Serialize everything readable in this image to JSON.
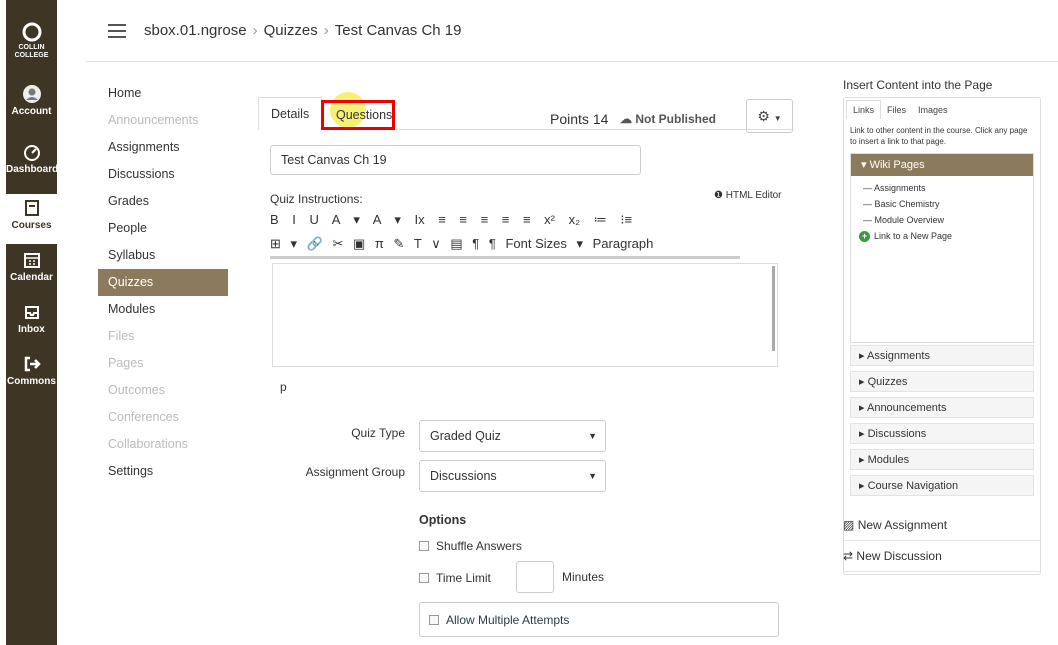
{
  "global_nav": {
    "logo": "COLLIN\nCOLLEGE",
    "account": "Account",
    "dashboard": "Dashboard",
    "courses": "Courses",
    "calendar": "Calendar",
    "inbox": "Inbox",
    "commons": "Commons"
  },
  "breadcrumb": {
    "course": "sbox.01.ngrose",
    "section": "Quizzes",
    "page": "Test Canvas Ch 19"
  },
  "course_nav": [
    "Home",
    "Announcements",
    "Assignments",
    "Discussions",
    "Grades",
    "People",
    "Syllabus",
    "Quizzes",
    "Modules",
    "Files",
    "Pages",
    "Outcomes",
    "Conferences",
    "Collaborations",
    "Settings"
  ],
  "course_nav_disabled": [
    1,
    9,
    10,
    11,
    12,
    13
  ],
  "course_nav_active": 7,
  "tabs": {
    "details": "Details",
    "questions": "Questions"
  },
  "points_label": "Points",
  "points_value": "14",
  "status": "Not Published",
  "quiz_title": "Test Canvas Ch 19",
  "instructions_label": "Quiz Instructions:",
  "html_editor": "HTML Editor",
  "toolbar1": "B I U A ▾ A ▾ Ix ≡ ≡ ≡ ≡ ≡ x² x₂ ≔ ⁝≡",
  "toolbar2": "⊞ ▾ 🔗 ✂ ▣ π ✎ T ∨ ▤ ¶ ¶",
  "font_sizes": "Font Sizes",
  "paragraph": "Paragraph",
  "editor_path": "p",
  "quiz_type_label": "Quiz Type",
  "quiz_type_value": "Graded Quiz",
  "assignment_group_label": "Assignment Group",
  "assignment_group_value": "Discussions",
  "options_heading": "Options",
  "shuffle": "Shuffle Answers",
  "time_limit": "Time Limit",
  "minutes": "Minutes",
  "multiple_attempts": "Allow Multiple Attempts",
  "side": {
    "title": "Insert Content into the Page",
    "tabs": [
      "Links",
      "Files",
      "Images"
    ],
    "help": "Link to other content in the course. Click any page to insert a link to that page.",
    "wiki_header": "Wiki Pages",
    "wiki_items": [
      "Assignments",
      "Basic Chemistry",
      "Module Overview"
    ],
    "new_page": "Link to a New Page",
    "sections": [
      "Assignments",
      "Quizzes",
      "Announcements",
      "Discussions",
      "Modules",
      "Course Navigation"
    ],
    "new_assignment": "New Assignment",
    "new_discussion": "New Discussion"
  }
}
